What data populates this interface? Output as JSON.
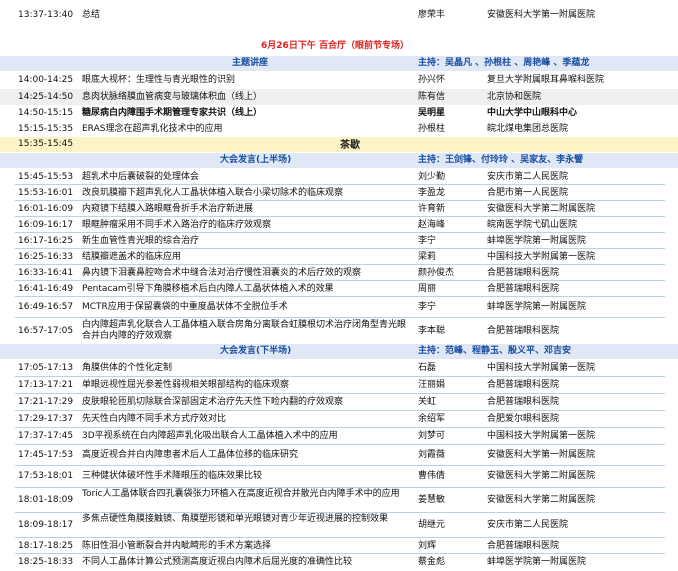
{
  "session_header": {
    "title": "6月26日下午  百合厅（眼前节专场）"
  },
  "rows": [
    {
      "time": "13:37-13:40",
      "topic": "总结",
      "speaker": "廖荣丰",
      "org": "安徽医科大学第一附属医院"
    },
    {
      "time": "14:00-14:25",
      "topic": "眼底大视杯：生理性与青光眼性的识别",
      "speaker": "孙兴怀",
      "org": "复旦大学附属眼耳鼻喉科医院"
    },
    {
      "time": "14:25-14:50",
      "topic": "息肉状脉络膜血管病变与玻璃体积血（线上）",
      "speaker": "陈有信",
      "org": "北京协和医院"
    },
    {
      "time": "14:50-15:15",
      "topic": "糖尿病白内障围手术期管理专家共识（线上）",
      "speaker": "吴明星",
      "org": "中山大学中山眼科中心"
    },
    {
      "time": "15:15-15:35",
      "topic": "ERAS理念在超声乳化技术中的应用",
      "speaker": "孙根柱",
      "org": "皖北煤电集团总医院"
    },
    {
      "time": "15:35-15:45",
      "topic": "",
      "speaker": "",
      "org": ""
    },
    {
      "time": "15:45-15:53",
      "topic": "超乳术中后囊破裂的处理体会",
      "speaker": "刘少勤",
      "org": "安庆市第二人民医院"
    },
    {
      "time": "15:53-16:01",
      "topic": "改良玑膜瓣下超声乳化人工晶状体植入联合小梁切除术的临床观察",
      "speaker": "李盈龙",
      "org": "合肥市第一人民医院"
    },
    {
      "time": "16:01-16:09",
      "topic": "内窥镜下结膜入路眼眶骨折手术治疗新进展",
      "speaker": "许育新",
      "org": "安徽医科大学第二附属医院"
    },
    {
      "time": "16:09-16:17",
      "topic": "眼眶肿瘤采用不同手术入路治疗的临床疗效观察",
      "speaker": "赵海峰",
      "org": "皖南医学院弋矶山医院"
    },
    {
      "time": "16:17-16:25",
      "topic": "新生血管性青光眼的综合治疗",
      "speaker": "李宁",
      "org": "蚌埠医学院第一附属医院"
    },
    {
      "time": "16:25-16:33",
      "topic": "结膜瓣遮盖术的临床应用",
      "speaker": "梁莉",
      "org": "中国科技大学附属第一医院"
    },
    {
      "time": "16:33-16:41",
      "topic": "鼻内镜下泪囊鼻腔吻合术中缝合法对治疗慢性泪囊炎的术后疗效的观察",
      "speaker": "颜孙俊杰",
      "org": "合肥普瑞眼科医院"
    },
    {
      "time": "16:41-16:49",
      "topic": "Pentacam引导下角膜移植术后白内障人工晶状体植入术的效果",
      "speaker": "周丽",
      "org": "合肥普瑞眼科医院"
    },
    {
      "time": "16:49-16:57",
      "topic": "MCTR应用于保留囊袋的中重度晶状体不全脱位手术",
      "speaker": "李宁",
      "org": "蚌埠医学院第一附属医院"
    },
    {
      "time": "16:57-17:05",
      "topic": "白内障超声乳化联合人工晶体植入联合房角分离联合虹膜根切术治疗闭角型青光眼合并白内障的疗效观察",
      "speaker": "李本聪",
      "org": "合肥普瑞眼科医院"
    },
    {
      "time": "17:05-17:13",
      "topic": "角膜供体的个性化定制",
      "speaker": "石磊",
      "org": "中国科技大学附属第一医院"
    },
    {
      "time": "17:13-17:21",
      "topic": "单眼远视性屈光参差性弱视相关眼部结构的临床观察",
      "speaker": "汪丽娟",
      "org": "合肥普瑞眼科医院"
    },
    {
      "time": "17:21-17:29",
      "topic": "皮肤眼轮匝肌切除联合深部固定术治疗先天性下睑内翻的疗效观察",
      "speaker": "关虹",
      "org": "合肥普瑞眼科医院"
    },
    {
      "time": "17:29-17:37",
      "topic": "先天性白内障不同手术方式疗效对比",
      "speaker": "余绍军",
      "org": "合肥爱尔眼科医院"
    },
    {
      "time": "17:37-17:45",
      "topic": "3D平视系统在白内障超声乳化吸出联合人工晶体植入术中的应用",
      "speaker": "刘梦可",
      "org": "中国科技大学附属第一医院"
    },
    {
      "time": "17:45-17:53",
      "topic": "高度近视合并白内障患者术后人工晶体位移的临床研究",
      "speaker": "刘霞薇",
      "org": "安徽医科大学第一附属医院"
    },
    {
      "time": "17:53-18:01",
      "topic": "三种健状体破坏性手术降眼压的临床效果比较",
      "speaker": "曹伟倩",
      "org": "安徽医科大学第二附属医院"
    },
    {
      "time": "18:01-18:09",
      "topic": "Toric人工晶体联合四孔囊袋张力环植入在高度近视合并散光白内障手术中的应用",
      "speaker": "姜慧敏",
      "org": "安徽医科大学第二附属医院"
    },
    {
      "time": "18:09-18:17",
      "topic": "多焦点硬性角膜接触镜、角膜塑形镜和单光眼镜对青少年近视进展的控制效果",
      "speaker": "胡继元",
      "org": "安庆市第二人民医院"
    },
    {
      "time": "18:17-18:25",
      "topic": "陈旧性泪小管断裂合并内眦畸形的手术方案选择",
      "speaker": "刘辉",
      "org": "合肥普瑞眼科医院"
    },
    {
      "time": "18:25-18:33",
      "topic": "不同人工晶体计算公式预测高度近视白内障术后屈光度的准确性比较",
      "speaker": "蔡金彪",
      "org": "蚌埠医学院第一附属医院"
    }
  ],
  "sections": {
    "keynote": {
      "title": "主题讲座",
      "chair": "主持：吴晶凡 、孙根柱 、周艳峰 、季蕴龙"
    },
    "tea": {
      "title": "茶歇"
    },
    "talks1": {
      "title": "大会发言(上半场)",
      "chair": "主持：王剑锋、付玲玲 、吴家友、李永譬"
    },
    "talks2": {
      "title": "大会发言(下半场)",
      "chair": "主持：范峰、程静玉、殷义平、邓吉安"
    }
  }
}
